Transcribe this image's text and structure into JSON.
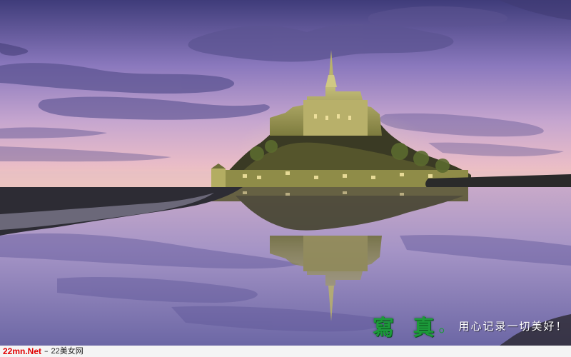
{
  "photo": {
    "subject": "mont-saint-michel-at-dusk",
    "colors": {
      "sky_top": "#3f3c7a",
      "sky_mid": "#a58ec8",
      "sky_low": "#e7b8c6",
      "horizon": "#f0c6b6",
      "water": "#8c83b8",
      "castle": "#a5a15a",
      "shore": "#2c2a35"
    }
  },
  "watermark": {
    "logo": "寫 真",
    "dot": "。",
    "slogan": "用心记录一切美好！"
  },
  "footer": {
    "url": "22mn.Net",
    "separator": "–",
    "site_name": "22美女网"
  }
}
